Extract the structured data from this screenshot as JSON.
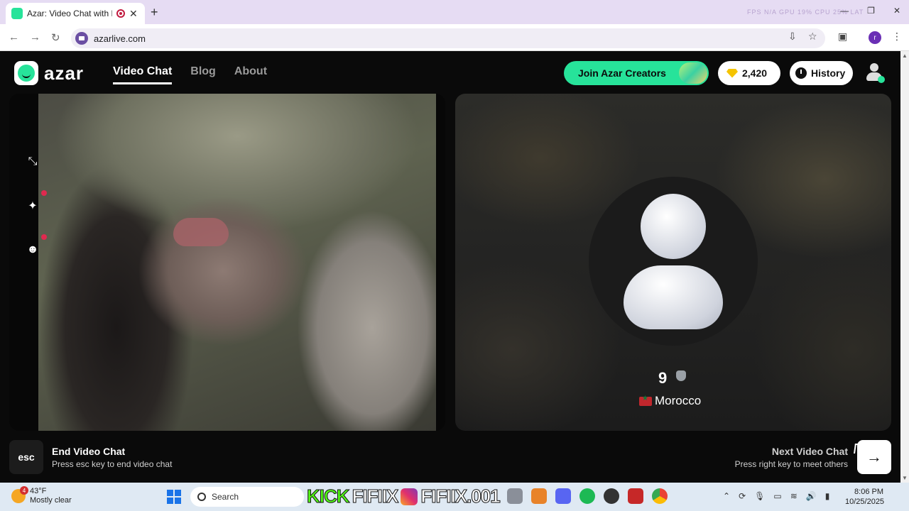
{
  "browser": {
    "tab_title": "Azar: Video Chat with New",
    "tab_close": "✕",
    "new_tab": "+",
    "url": "azarlive.com",
    "hud_text": "FPS N/A  GPU 19%  CPU 25%  LAT",
    "profile_initial": "r"
  },
  "site": {
    "logo_text": "azar",
    "nav": [
      {
        "label": "Video Chat",
        "active": true
      },
      {
        "label": "Blog",
        "active": false
      },
      {
        "label": "About",
        "active": false
      }
    ],
    "join_creators_label": "Join Azar Creators",
    "gems_count": "2,420",
    "history_label": "History"
  },
  "peer": {
    "age": "9",
    "country": "Morocco"
  },
  "controls": {
    "esc_key": "esc",
    "end_title": "End Video Chat",
    "end_subtitle": "Press esc key to end video chat",
    "next_title": "Next Video Chat",
    "next_subtitle": "Press right key to meet others",
    "next_arrow": "→"
  },
  "taskbar": {
    "temperature": "43°F",
    "weather": "Mostly clear",
    "weather_badge": "4",
    "search_label": "Search",
    "stream_kick": "KICK",
    "stream_name_1": "FIFIIX",
    "stream_name_2": "FIFIIX.001",
    "time": "8:06 PM",
    "date": "10/25/2025"
  },
  "colors": {
    "brand_green": "#27e39a",
    "notification_red": "#e0294f",
    "gem_gold": "#f5c400"
  }
}
